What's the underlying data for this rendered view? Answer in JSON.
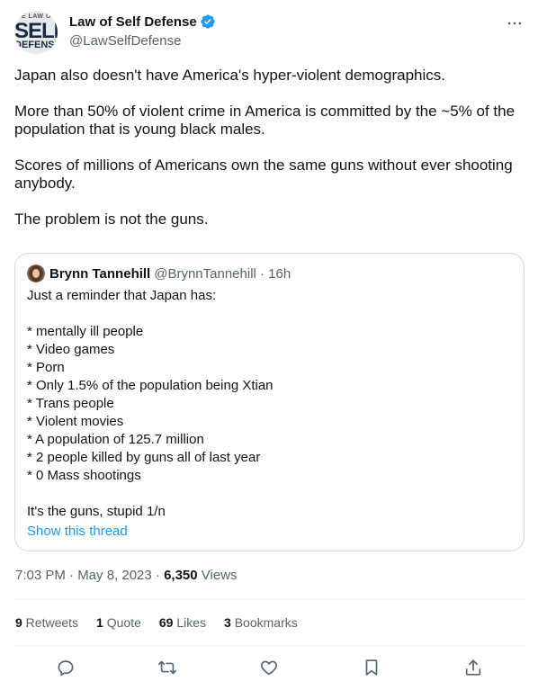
{
  "author": {
    "avatar_text": {
      "top": "HE LAW OF",
      "middle": "SELF",
      "bottom": "DEFENSE"
    },
    "display_name": "Law of Self Defense",
    "handle": "@LawSelfDefense",
    "verified_icon": "verified-badge-icon",
    "verified_color": "#1d9bf0"
  },
  "tweet": {
    "paragraphs": [
      "Japan also doesn't have America's hyper-violent demographics.",
      "More than 50% of violent crime in America is committed by the ~5% of the population that is young black males.",
      "Scores of millions of Americans own the same guns without ever shooting anybody.",
      "The problem is not the guns."
    ]
  },
  "quote": {
    "name": "Brynn Tannehill",
    "handle_time": "@BrynnTannehill · 16h",
    "lines": [
      "Just a reminder that Japan has:",
      "",
      "* mentally ill people",
      "* Video games",
      "* Porn",
      "* Only 1.5% of the population being Xtian",
      "* Trans people",
      "* Violent movies",
      "* A population of 125.7 million",
      "* 2 people killed by guns all of last year",
      "* 0 Mass shootings",
      "",
      "It's the guns, stupid 1/n"
    ],
    "show_thread": "Show this thread"
  },
  "meta": {
    "time_date": "7:03 PM · May 8, 2023 · ",
    "views_count": "6,350",
    "views_label": " Views"
  },
  "stats": {
    "retweets": {
      "count": "9",
      "label": " Retweets"
    },
    "quotes": {
      "count": "1",
      "label": " Quote"
    },
    "likes": {
      "count": "69",
      "label": " Likes"
    },
    "bookmarks": {
      "count": "3",
      "label": " Bookmarks"
    }
  },
  "icons": [
    "more-icon",
    "reply-icon",
    "retweet-icon",
    "like-icon",
    "bookmark-icon",
    "share-icon"
  ]
}
